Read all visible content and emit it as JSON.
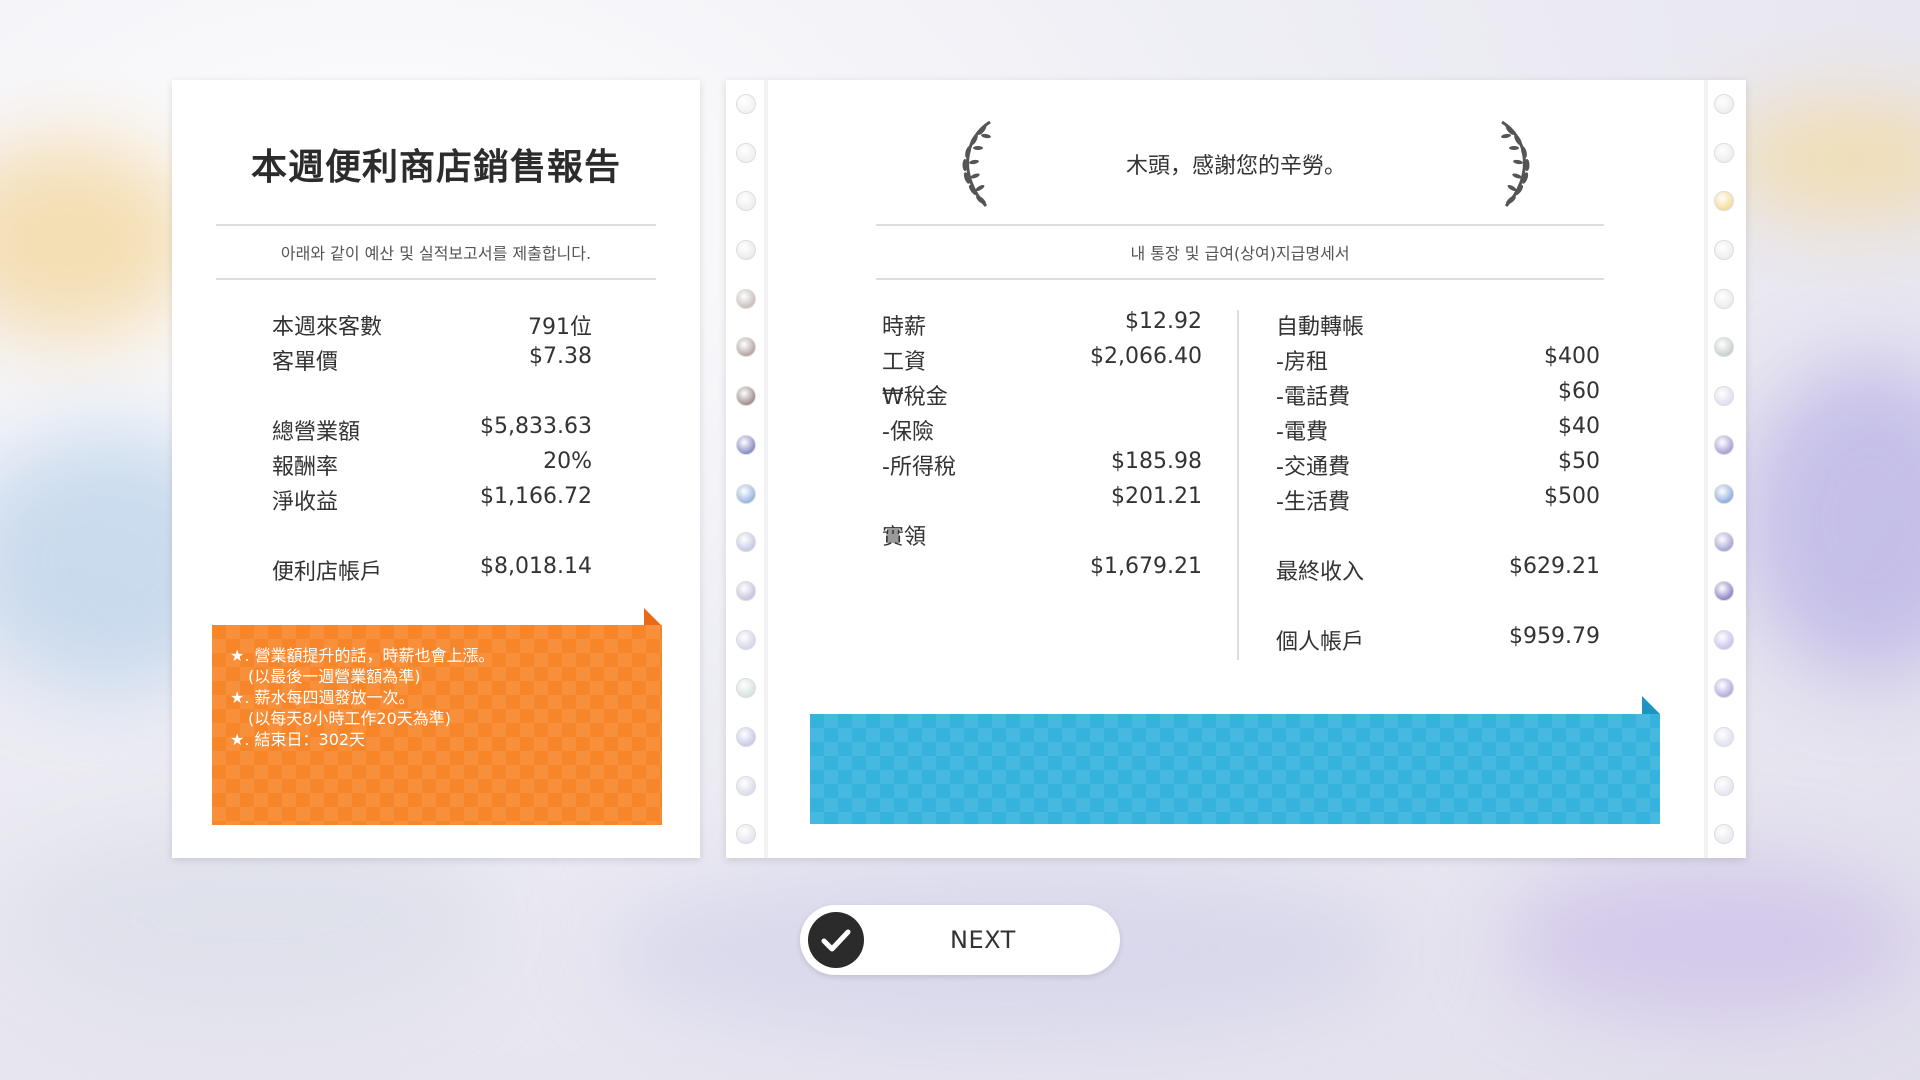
{
  "left_card": {
    "title": "本週便利商店銷售報告",
    "subtitle": "아래와 같이 예산 및 실적보고서를 제출합니다.",
    "rows": [
      {
        "label": "本週來客數",
        "value": "791位"
      },
      {
        "label": "客單價",
        "value": "$7.38"
      },
      {
        "label": "總營業額",
        "value": "$5,833.63"
      },
      {
        "label": "報酬率",
        "value": "20%"
      },
      {
        "label": "淨收益",
        "value": "$1,166.72"
      },
      {
        "label": "便利店帳戶",
        "value": "$8,018.14"
      }
    ],
    "notes": [
      "★. 營業額提升的話，時薪也會上漲。",
      "   (以最後一週營業額為準)",
      "★. 薪水每四週發放一次。",
      "   (以每天8小時工作20天為準)",
      "★. 結束日：302天"
    ],
    "note_color": "#f7852a"
  },
  "right_card": {
    "thanks": "木頭，感謝您的辛勞。",
    "subtitle": "내 통장 및 급여(상여)지급명세서",
    "left_rows": [
      {
        "label": "時薪",
        "value": "$12.92"
      },
      {
        "label": "工資",
        "value": "$2,066.40"
      },
      {
        "label": "₩稅金",
        "value": ""
      },
      {
        "label": "-保險",
        "value": ""
      },
      {
        "label": "-所得稅",
        "value": "$185.98"
      },
      {
        "label": "",
        "value": "$201.21"
      },
      {
        "label": "實領",
        "value": ""
      },
      {
        "label": "",
        "value": "$1,679.21"
      }
    ],
    "right_rows": [
      {
        "label": "自動轉帳",
        "value": ""
      },
      {
        "label": "-房租",
        "value": "$400"
      },
      {
        "label": "-電話費",
        "value": "$60"
      },
      {
        "label": "-電費",
        "value": "$40"
      },
      {
        "label": "-交通費",
        "value": "$50"
      },
      {
        "label": "-生活費",
        "value": "$500"
      },
      {
        "label": "最終收入",
        "value": "$629.21"
      },
      {
        "label": "個人帳戶",
        "value": "$959.79"
      }
    ],
    "band_color": "#35b3dc",
    "hole_colors_left": [
      "#f2f2f2",
      "#f0f0f0",
      "#eeeeee",
      "#ebebeb",
      "#c9c0bd",
      "#b5a8a6",
      "#a39090",
      "#8a8fc6",
      "#9bb7de",
      "#c6cbe4",
      "#c6c6e0",
      "#d6d6ea",
      "#d8e3df",
      "#c9cbe8",
      "#dcdcec",
      "#e6e6f0"
    ],
    "hole_colors_right": [
      "#eeeeee",
      "#eeeeee",
      "#f5dd9a",
      "#eeeeee",
      "#ececec",
      "#c9d2d0",
      "#e2def0",
      "#a7a2d9",
      "#94aee0",
      "#a9a6d6",
      "#9189c9",
      "#c9c6ee",
      "#b3aee0",
      "#e1e1f0",
      "#e6e6f0",
      "#e9e9f0"
    ]
  },
  "next_button": {
    "label": "NEXT",
    "icon": "check-circle-icon"
  }
}
